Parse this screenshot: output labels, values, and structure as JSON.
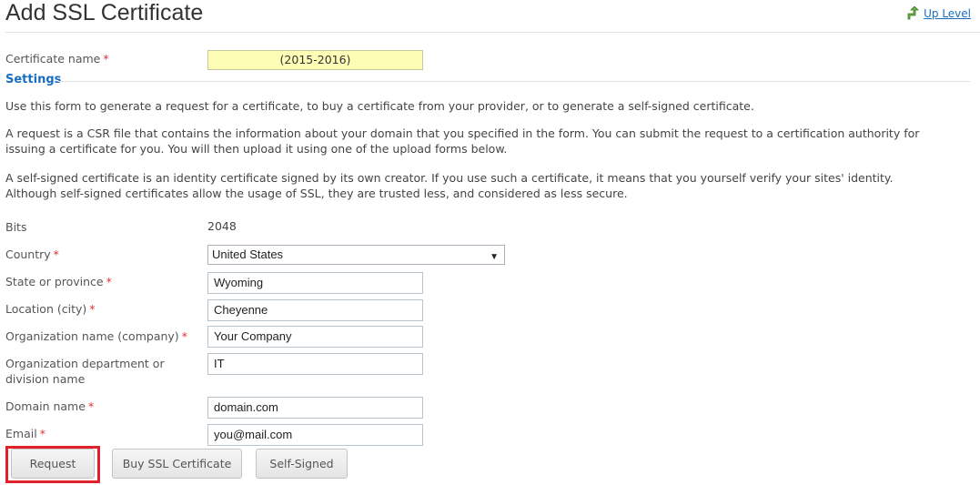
{
  "header": {
    "title": "Add SSL Certificate",
    "up_level": "Up Level",
    "up_level_icon": "up-arrow-icon"
  },
  "certificate": {
    "label": "Certificate name",
    "required_mark": "*",
    "value": "(2015-2016)"
  },
  "settings": {
    "heading": "Settings",
    "para1": "Use this form to generate a request for a certificate, to buy a certificate from your provider, or to generate a self-signed certificate.",
    "para2_line1": "A request is a CSR file that contains the information about your domain that you specified in the form. You can submit the request to a certification authority for",
    "para2_line2": "issuing a certificate for you. You will then upload it using one of the upload forms below.",
    "para3_line1": "A self-signed certificate is an identity certificate signed by its own creator. If you use such a certificate, it means that you yourself verify your sites' identity.",
    "para3_line2": "Although self-signed certificates allow the usage of SSL, they are trusted less, and considered as less secure."
  },
  "form": {
    "bits_label": "Bits",
    "bits_value": "2048",
    "country_label": "Country",
    "country_value": "United States",
    "state_label": "State or province",
    "state_value": "Wyoming",
    "city_label": "Location (city)",
    "city_value": "Cheyenne",
    "org_label": "Organization name (company)",
    "org_value": "Your Company",
    "dept_label_line1": "Organization department or",
    "dept_label_line2": "division name",
    "dept_value": "IT",
    "domain_label": "Domain name",
    "domain_value": "domain.com",
    "email_label": "Email",
    "email_value": "you@mail.com",
    "required_mark": "*"
  },
  "buttons": {
    "request": "Request",
    "buy": "Buy SSL Certificate",
    "self_signed": "Self-Signed"
  },
  "colors": {
    "accent": "#1a6ec2",
    "required": "#d33333",
    "highlight": "#e0202a",
    "cert_field_bg": "#fdfdb5"
  }
}
